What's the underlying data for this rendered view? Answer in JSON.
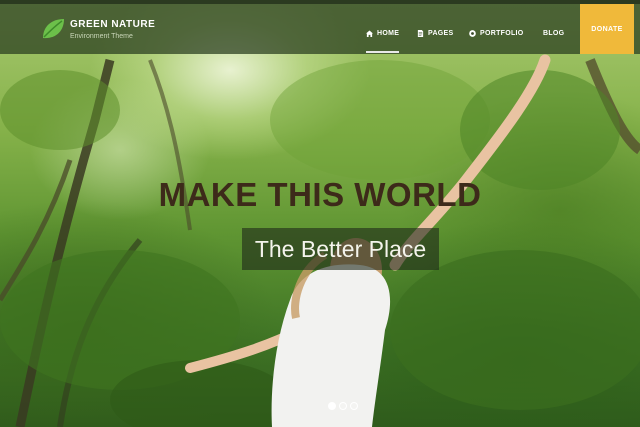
{
  "brand": {
    "name": "GREEN NATURE",
    "tagline": "Environment Theme",
    "logo_icon": "leaf-icon",
    "logo_color": "#6cc04a"
  },
  "nav": {
    "items": [
      {
        "label": "HOME",
        "icon": "home-icon",
        "active": true
      },
      {
        "label": "PAGES",
        "icon": "document-icon",
        "active": false
      },
      {
        "label": "PORTFOLIO",
        "icon": "camera-icon",
        "active": false
      },
      {
        "label": "BLOG",
        "icon": "",
        "active": false
      }
    ],
    "donate_label": "DONATE"
  },
  "hero": {
    "headline": "MAKE THIS WORLD",
    "subline": "The Better Place",
    "slides_count": 3,
    "active_slide": 1
  },
  "colors": {
    "header_bg": "#283c1e",
    "donate_bg": "#f0b93a",
    "headline_color": "#3d2a1a"
  }
}
